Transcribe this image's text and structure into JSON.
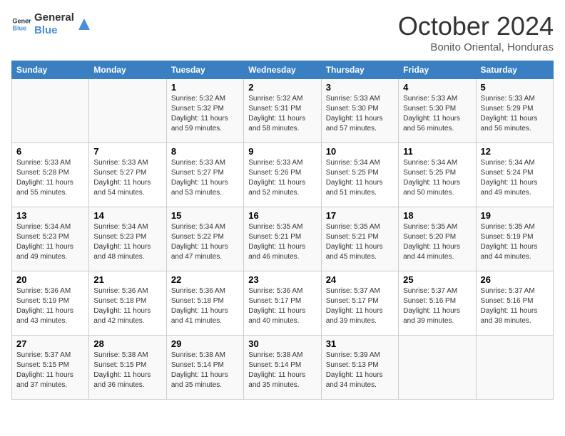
{
  "logo": {
    "line1": "General",
    "line2": "Blue"
  },
  "title": "October 2024",
  "location": "Bonito Oriental, Honduras",
  "weekdays": [
    "Sunday",
    "Monday",
    "Tuesday",
    "Wednesday",
    "Thursday",
    "Friday",
    "Saturday"
  ],
  "weeks": [
    [
      {
        "day": "",
        "info": ""
      },
      {
        "day": "",
        "info": ""
      },
      {
        "day": "1",
        "info": "Sunrise: 5:32 AM\nSunset: 5:32 PM\nDaylight: 11 hours and 59 minutes."
      },
      {
        "day": "2",
        "info": "Sunrise: 5:32 AM\nSunset: 5:31 PM\nDaylight: 11 hours and 58 minutes."
      },
      {
        "day": "3",
        "info": "Sunrise: 5:33 AM\nSunset: 5:30 PM\nDaylight: 11 hours and 57 minutes."
      },
      {
        "day": "4",
        "info": "Sunrise: 5:33 AM\nSunset: 5:30 PM\nDaylight: 11 hours and 56 minutes."
      },
      {
        "day": "5",
        "info": "Sunrise: 5:33 AM\nSunset: 5:29 PM\nDaylight: 11 hours and 56 minutes."
      }
    ],
    [
      {
        "day": "6",
        "info": "Sunrise: 5:33 AM\nSunset: 5:28 PM\nDaylight: 11 hours and 55 minutes."
      },
      {
        "day": "7",
        "info": "Sunrise: 5:33 AM\nSunset: 5:27 PM\nDaylight: 11 hours and 54 minutes."
      },
      {
        "day": "8",
        "info": "Sunrise: 5:33 AM\nSunset: 5:27 PM\nDaylight: 11 hours and 53 minutes."
      },
      {
        "day": "9",
        "info": "Sunrise: 5:33 AM\nSunset: 5:26 PM\nDaylight: 11 hours and 52 minutes."
      },
      {
        "day": "10",
        "info": "Sunrise: 5:34 AM\nSunset: 5:25 PM\nDaylight: 11 hours and 51 minutes."
      },
      {
        "day": "11",
        "info": "Sunrise: 5:34 AM\nSunset: 5:25 PM\nDaylight: 11 hours and 50 minutes."
      },
      {
        "day": "12",
        "info": "Sunrise: 5:34 AM\nSunset: 5:24 PM\nDaylight: 11 hours and 49 minutes."
      }
    ],
    [
      {
        "day": "13",
        "info": "Sunrise: 5:34 AM\nSunset: 5:23 PM\nDaylight: 11 hours and 49 minutes."
      },
      {
        "day": "14",
        "info": "Sunrise: 5:34 AM\nSunset: 5:23 PM\nDaylight: 11 hours and 48 minutes."
      },
      {
        "day": "15",
        "info": "Sunrise: 5:34 AM\nSunset: 5:22 PM\nDaylight: 11 hours and 47 minutes."
      },
      {
        "day": "16",
        "info": "Sunrise: 5:35 AM\nSunset: 5:21 PM\nDaylight: 11 hours and 46 minutes."
      },
      {
        "day": "17",
        "info": "Sunrise: 5:35 AM\nSunset: 5:21 PM\nDaylight: 11 hours and 45 minutes."
      },
      {
        "day": "18",
        "info": "Sunrise: 5:35 AM\nSunset: 5:20 PM\nDaylight: 11 hours and 44 minutes."
      },
      {
        "day": "19",
        "info": "Sunrise: 5:35 AM\nSunset: 5:19 PM\nDaylight: 11 hours and 44 minutes."
      }
    ],
    [
      {
        "day": "20",
        "info": "Sunrise: 5:36 AM\nSunset: 5:19 PM\nDaylight: 11 hours and 43 minutes."
      },
      {
        "day": "21",
        "info": "Sunrise: 5:36 AM\nSunset: 5:18 PM\nDaylight: 11 hours and 42 minutes."
      },
      {
        "day": "22",
        "info": "Sunrise: 5:36 AM\nSunset: 5:18 PM\nDaylight: 11 hours and 41 minutes."
      },
      {
        "day": "23",
        "info": "Sunrise: 5:36 AM\nSunset: 5:17 PM\nDaylight: 11 hours and 40 minutes."
      },
      {
        "day": "24",
        "info": "Sunrise: 5:37 AM\nSunset: 5:17 PM\nDaylight: 11 hours and 39 minutes."
      },
      {
        "day": "25",
        "info": "Sunrise: 5:37 AM\nSunset: 5:16 PM\nDaylight: 11 hours and 39 minutes."
      },
      {
        "day": "26",
        "info": "Sunrise: 5:37 AM\nSunset: 5:16 PM\nDaylight: 11 hours and 38 minutes."
      }
    ],
    [
      {
        "day": "27",
        "info": "Sunrise: 5:37 AM\nSunset: 5:15 PM\nDaylight: 11 hours and 37 minutes."
      },
      {
        "day": "28",
        "info": "Sunrise: 5:38 AM\nSunset: 5:15 PM\nDaylight: 11 hours and 36 minutes."
      },
      {
        "day": "29",
        "info": "Sunrise: 5:38 AM\nSunset: 5:14 PM\nDaylight: 11 hours and 35 minutes."
      },
      {
        "day": "30",
        "info": "Sunrise: 5:38 AM\nSunset: 5:14 PM\nDaylight: 11 hours and 35 minutes."
      },
      {
        "day": "31",
        "info": "Sunrise: 5:39 AM\nSunset: 5:13 PM\nDaylight: 11 hours and 34 minutes."
      },
      {
        "day": "",
        "info": ""
      },
      {
        "day": "",
        "info": ""
      }
    ]
  ]
}
